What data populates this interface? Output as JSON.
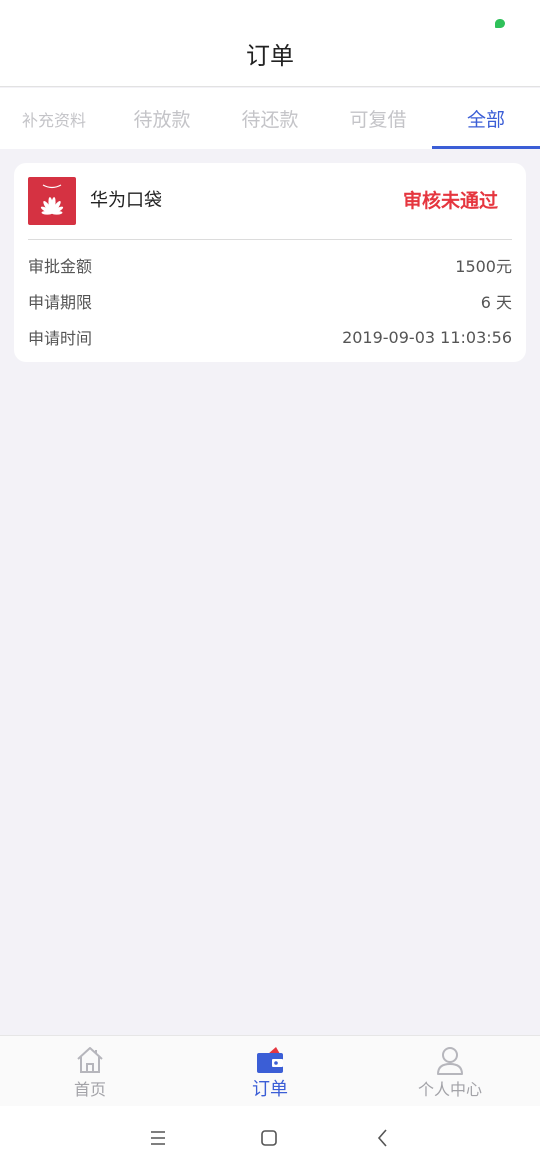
{
  "header": {
    "title": "订单"
  },
  "tabs": [
    {
      "label": "补充资料"
    },
    {
      "label": "待放款"
    },
    {
      "label": "待还款"
    },
    {
      "label": "可复借"
    },
    {
      "label": "全部"
    }
  ],
  "order": {
    "product_name": "华为口袋",
    "status": "审核未通过",
    "rows": [
      {
        "label": "审批金额",
        "value": "1500元"
      },
      {
        "label": "申请期限",
        "value": "6 天"
      },
      {
        "label": "申请时间",
        "value": "2019-09-03 11:03:56"
      }
    ]
  },
  "bottom_nav": [
    {
      "label": "首页",
      "icon": "home-icon"
    },
    {
      "label": "订单",
      "icon": "wallet-icon"
    },
    {
      "label": "个人中心",
      "icon": "person-icon"
    }
  ],
  "colors": {
    "accent": "#3b5ed6",
    "status_red": "#e5363f",
    "logo_red": "#d53242"
  }
}
